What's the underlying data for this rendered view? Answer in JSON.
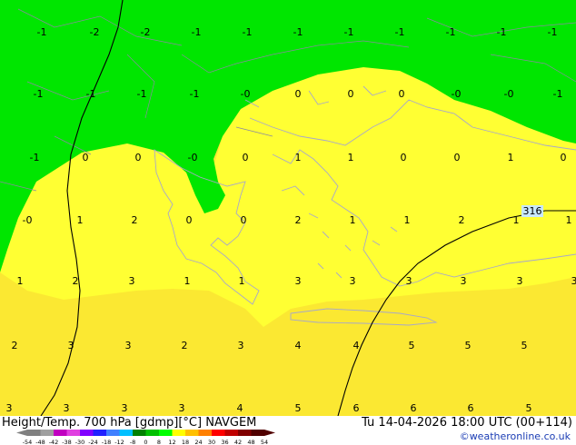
{
  "map": {
    "title": "Height/Temp. 700 hPa [gdmp][°C] NAVGEM",
    "valid_time": "Tu 14-04-2026 18:00 UTC (00+114)",
    "credit": "©weatheronline.co.uk",
    "contour_label": "316",
    "colors": {
      "cold_fill": "#00e600",
      "mild_fill": "#ffff33",
      "warm_fill": "#fbe832",
      "coast": "#a8a8c8"
    },
    "legend": {
      "ticks": [
        "-54",
        "-48",
        "-42",
        "-38",
        "-30",
        "-24",
        "-18",
        "-12",
        "-8",
        "0",
        "8",
        "12",
        "18",
        "24",
        "30",
        "36",
        "42",
        "48",
        "54"
      ],
      "colors": [
        "#808080",
        "#a0a0a0",
        "#c000c0",
        "#e040e0",
        "#8000ff",
        "#2020ff",
        "#4080ff",
        "#00c0ff",
        "#008000",
        "#00c000",
        "#00ff00",
        "#ffff00",
        "#ffc000",
        "#ff8000",
        "#ff0000",
        "#c00000",
        "#800000",
        "#500000"
      ]
    },
    "values": [
      [
        "-1",
        "-2",
        "-2",
        "-1",
        "-1",
        "-1",
        "-1",
        "-1",
        "-1",
        "-1",
        "-1"
      ],
      [
        "-1",
        "-1",
        "-1",
        "-1",
        "-0",
        "0",
        "0",
        "0",
        "-0",
        "-0",
        "-1"
      ],
      [
        "-1",
        "0",
        "0",
        "-0",
        "0",
        "1",
        "1",
        "0",
        "0",
        "1",
        "0"
      ],
      [
        "-0",
        "1",
        "2",
        "0",
        "0",
        "2",
        "1",
        "1",
        "2",
        "1",
        "1"
      ],
      [
        "1",
        "2",
        "3",
        "1",
        "1",
        "3",
        "3",
        "3",
        "3",
        "3",
        "3"
      ],
      [
        "2",
        "3",
        "3",
        "2",
        "3",
        "4",
        "4",
        "5",
        "5",
        "5"
      ],
      [
        "3",
        "3",
        "3",
        "3",
        "4",
        "5",
        "6",
        "6",
        "6",
        "5"
      ]
    ]
  }
}
